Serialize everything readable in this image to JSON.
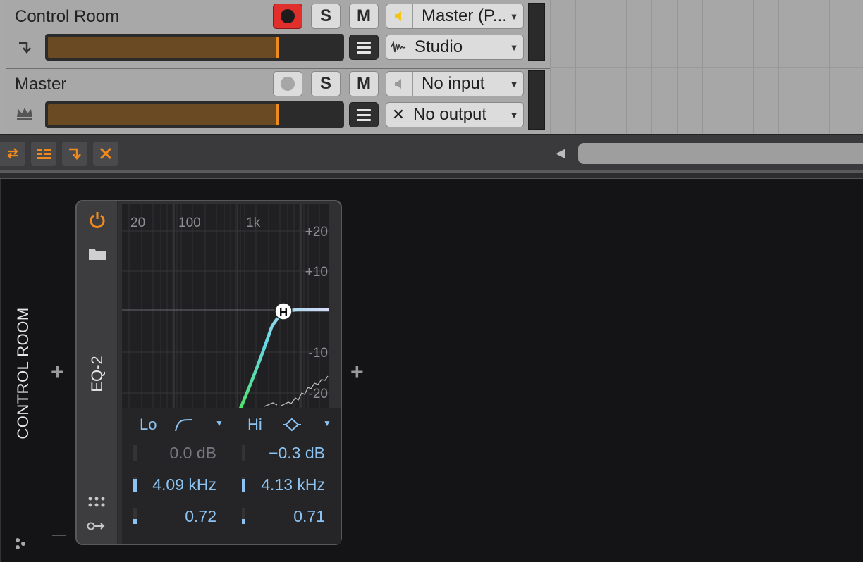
{
  "tracks": [
    {
      "name": "Control Room",
      "record_active": true,
      "solo": "S",
      "mute": "M",
      "input": "Master (P...",
      "output": "Studio",
      "meter_level": 0.78
    },
    {
      "name": "Master",
      "record_active": false,
      "solo": "S",
      "mute": "M",
      "input": "No input",
      "output": "No output",
      "meter_level": 0.78
    }
  ],
  "chain": {
    "label": "CONTROL ROOM",
    "add_before": "+",
    "add_after": "+"
  },
  "device": {
    "name": "EQ-2",
    "freq_ticks": [
      "20",
      "100",
      "1k"
    ],
    "db_ticks": [
      "+20",
      "+10",
      "-10",
      "-20"
    ],
    "node_label": "H",
    "band_lo": {
      "label": "Lo",
      "gain": "0.0 dB",
      "freq": "4.09 kHz",
      "q": "0.72",
      "freq_level": 0.85,
      "q_level": 0.3
    },
    "band_hi": {
      "label": "Hi",
      "gain": "−0.3 dB",
      "freq": "4.13 kHz",
      "q": "0.71",
      "freq_level": 0.85,
      "q_level": 0.3
    }
  },
  "colors": {
    "accent": "#f08a1d",
    "record": "#e1302b",
    "param_blue": "#8cc3f2",
    "meter_fill": "#6a4a22"
  }
}
